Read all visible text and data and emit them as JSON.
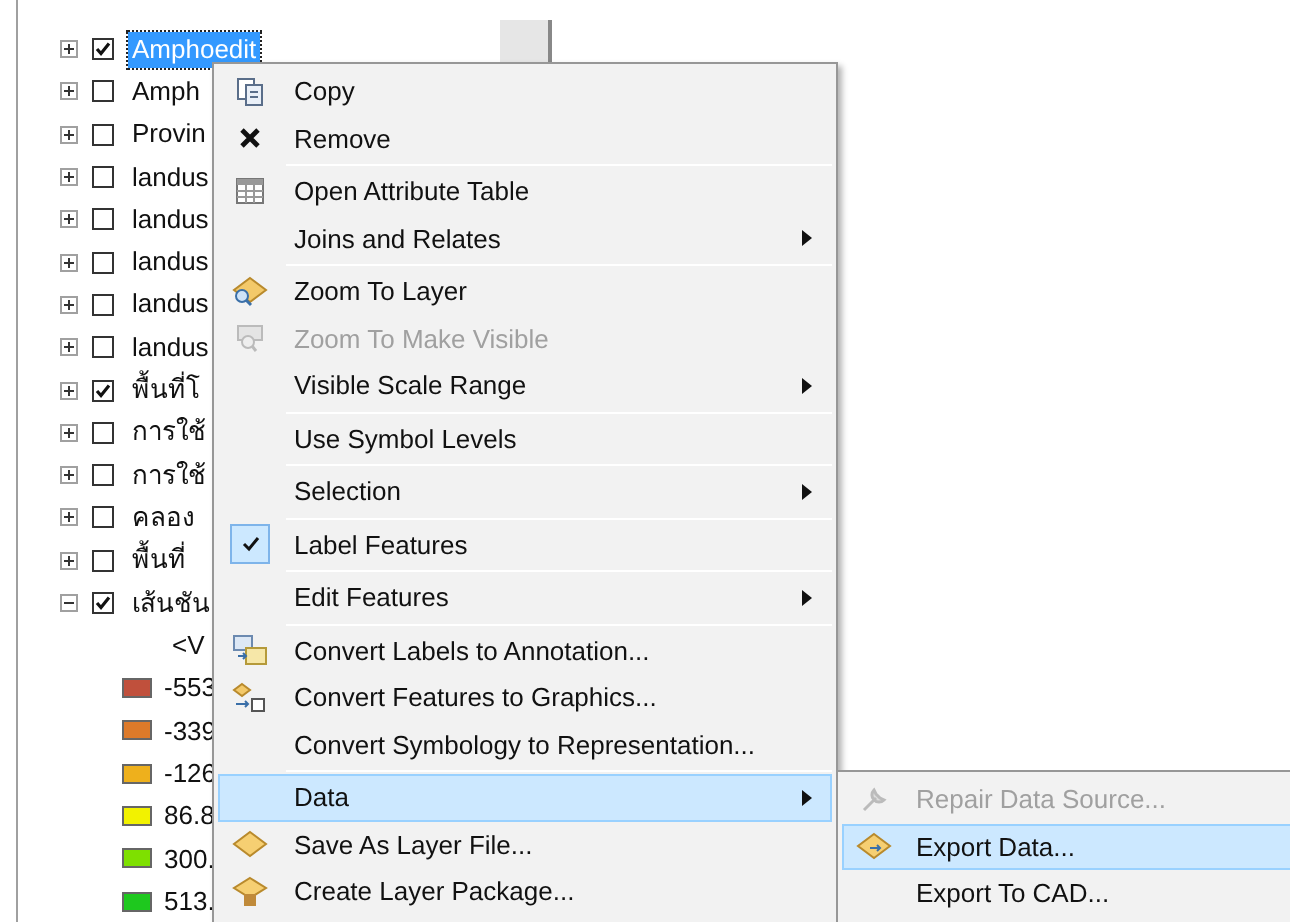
{
  "tree": [
    {
      "kind": "layer",
      "label": "Amphoedit",
      "checked": true,
      "expanded": false,
      "selected": true
    },
    {
      "kind": "layer",
      "label": "Amph",
      "checked": false,
      "expanded": false,
      "selected": false
    },
    {
      "kind": "layer",
      "label": "Provin",
      "checked": false,
      "expanded": false,
      "selected": false
    },
    {
      "kind": "layer",
      "label": "landus",
      "checked": false,
      "expanded": false,
      "selected": false
    },
    {
      "kind": "layer",
      "label": "landus",
      "checked": false,
      "expanded": false,
      "selected": false
    },
    {
      "kind": "layer",
      "label": "landus",
      "checked": false,
      "expanded": false,
      "selected": false
    },
    {
      "kind": "layer",
      "label": "landus",
      "checked": false,
      "expanded": false,
      "selected": false
    },
    {
      "kind": "layer",
      "label": "landus",
      "checked": false,
      "expanded": false,
      "selected": false
    },
    {
      "kind": "layer",
      "label": "พื้นที่โ",
      "checked": true,
      "expanded": false,
      "selected": false
    },
    {
      "kind": "layer",
      "label": "การใช้",
      "checked": false,
      "expanded": false,
      "selected": false
    },
    {
      "kind": "layer",
      "label": "การใช้",
      "checked": false,
      "expanded": false,
      "selected": false
    },
    {
      "kind": "layer",
      "label": "คลอง",
      "checked": false,
      "expanded": false,
      "selected": false
    },
    {
      "kind": "layer",
      "label": "พื้นที่",
      "checked": false,
      "expanded": false,
      "selected": false
    },
    {
      "kind": "layer",
      "label": "เส้นชัน",
      "checked": true,
      "expanded": true,
      "selected": false
    },
    {
      "kind": "header",
      "label": "<V"
    },
    {
      "kind": "legend",
      "label": "-553",
      "color": "#c0503c"
    },
    {
      "kind": "legend",
      "label": "-339",
      "color": "#dd7a2a"
    },
    {
      "kind": "legend",
      "label": "-126",
      "color": "#eeb01c"
    },
    {
      "kind": "legend",
      "label": "86.8",
      "color": "#f2f200"
    },
    {
      "kind": "legend",
      "label": "300.",
      "color": "#7ee000"
    },
    {
      "kind": "legend",
      "label": "513.",
      "color": "#1ec81e"
    }
  ],
  "context_menu": [
    {
      "kind": "item",
      "label": "Copy",
      "disabled": false,
      "submenu": false,
      "checked": false,
      "selected": false
    },
    {
      "kind": "item",
      "label": "Remove",
      "disabled": false,
      "submenu": false,
      "checked": false,
      "selected": false
    },
    {
      "kind": "separator"
    },
    {
      "kind": "item",
      "label": "Open Attribute Table",
      "disabled": false,
      "submenu": false,
      "checked": false,
      "selected": false
    },
    {
      "kind": "item",
      "label": "Joins and Relates",
      "disabled": false,
      "submenu": true,
      "checked": false,
      "selected": false
    },
    {
      "kind": "separator"
    },
    {
      "kind": "item",
      "label": "Zoom To Layer",
      "disabled": false,
      "submenu": false,
      "checked": false,
      "selected": false
    },
    {
      "kind": "item",
      "label": "Zoom To Make Visible",
      "disabled": true,
      "submenu": false,
      "checked": false,
      "selected": false
    },
    {
      "kind": "item",
      "label": "Visible Scale Range",
      "disabled": false,
      "submenu": true,
      "checked": false,
      "selected": false
    },
    {
      "kind": "separator"
    },
    {
      "kind": "item",
      "label": "Use Symbol Levels",
      "disabled": false,
      "submenu": false,
      "checked": false,
      "selected": false
    },
    {
      "kind": "separator"
    },
    {
      "kind": "item",
      "label": "Selection",
      "disabled": false,
      "submenu": true,
      "checked": false,
      "selected": false
    },
    {
      "kind": "separator"
    },
    {
      "kind": "item",
      "label": "Label Features",
      "disabled": false,
      "submenu": false,
      "checked": true,
      "selected": false
    },
    {
      "kind": "separator"
    },
    {
      "kind": "item",
      "label": "Edit Features",
      "disabled": false,
      "submenu": true,
      "checked": false,
      "selected": false
    },
    {
      "kind": "separator"
    },
    {
      "kind": "item",
      "label": "Convert Labels to Annotation...",
      "disabled": false,
      "submenu": false,
      "checked": false,
      "selected": false
    },
    {
      "kind": "item",
      "label": "Convert Features to Graphics...",
      "disabled": false,
      "submenu": false,
      "checked": false,
      "selected": false
    },
    {
      "kind": "item",
      "label": "Convert Symbology to Representation...",
      "disabled": false,
      "submenu": false,
      "checked": false,
      "selected": false
    },
    {
      "kind": "separator"
    },
    {
      "kind": "item",
      "label": "Data",
      "disabled": false,
      "submenu": true,
      "checked": false,
      "selected": true
    },
    {
      "kind": "item",
      "label": "Save As Layer File...",
      "disabled": false,
      "submenu": false,
      "checked": false,
      "selected": false
    },
    {
      "kind": "item",
      "label": "Create Layer Package...",
      "disabled": false,
      "submenu": false,
      "checked": false,
      "selected": false
    }
  ],
  "data_submenu": [
    {
      "label": "Repair Data Source...",
      "disabled": true,
      "selected": false
    },
    {
      "label": "Export Data...",
      "disabled": false,
      "selected": true
    },
    {
      "label": "Export To CAD...",
      "disabled": false,
      "selected": false
    }
  ]
}
